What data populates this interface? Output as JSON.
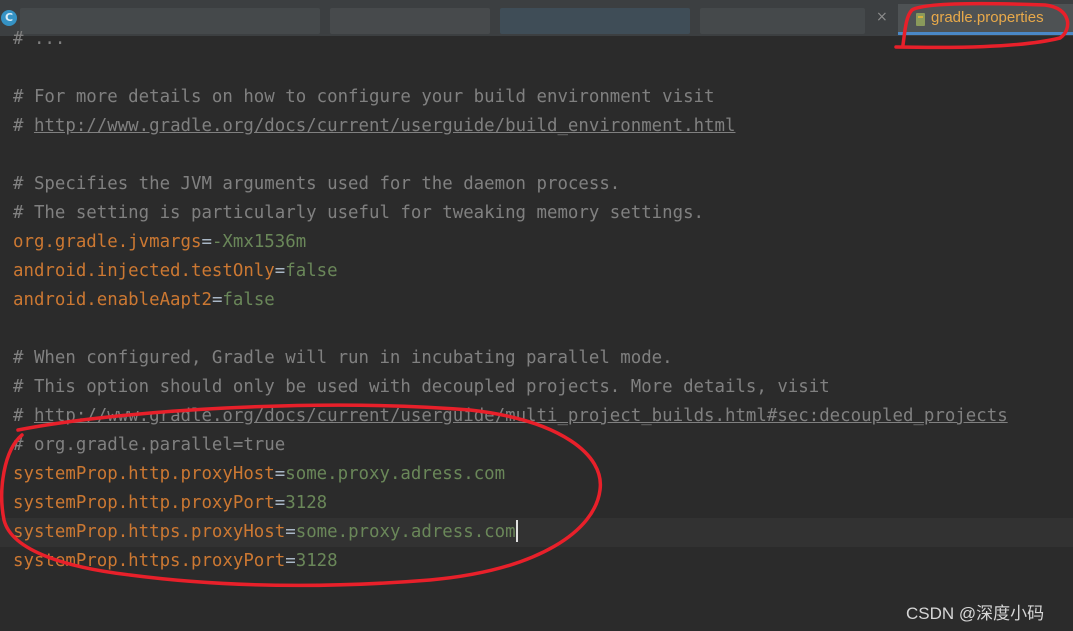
{
  "tab_bar": {
    "close_glyph": "×",
    "file_icon_char": "C",
    "active_tab_label": "gradle.properties"
  },
  "editor": {
    "lines": [
      {
        "parts": [
          {
            "t": "# ...",
            "c": "cmt"
          }
        ]
      },
      {
        "parts": []
      },
      {
        "parts": [
          {
            "t": "# For more details on how to configure your build environment visit",
            "c": "cmt"
          }
        ]
      },
      {
        "parts": [
          {
            "t": "# ",
            "c": "cmt"
          },
          {
            "t": "http://www.gradle.org/docs/current/userguide/build_environment.html",
            "c": "cmt-link"
          }
        ]
      },
      {
        "parts": []
      },
      {
        "parts": [
          {
            "t": "# Specifies the JVM arguments used for the daemon process.",
            "c": "cmt"
          }
        ]
      },
      {
        "parts": [
          {
            "t": "# The setting is particularly useful for tweaking memory settings.",
            "c": "cmt"
          }
        ]
      },
      {
        "parts": [
          {
            "t": "org.gradle.jvmargs",
            "c": "key"
          },
          {
            "t": "=",
            "c": "eq"
          },
          {
            "t": "-Xmx1536m",
            "c": "val"
          }
        ]
      },
      {
        "parts": [
          {
            "t": "android.injected.testOnly",
            "c": "key"
          },
          {
            "t": "=",
            "c": "eq"
          },
          {
            "t": "false",
            "c": "val"
          }
        ]
      },
      {
        "parts": [
          {
            "t": "android.enableAapt2",
            "c": "key"
          },
          {
            "t": "=",
            "c": "eq"
          },
          {
            "t": "false",
            "c": "val"
          }
        ]
      },
      {
        "parts": []
      },
      {
        "parts": [
          {
            "t": "# When configured, Gradle will run in incubating parallel mode.",
            "c": "cmt"
          }
        ]
      },
      {
        "parts": [
          {
            "t": "# This option should only be used with decoupled projects. More details, visit",
            "c": "cmt"
          }
        ]
      },
      {
        "parts": [
          {
            "t": "# ",
            "c": "cmt"
          },
          {
            "t": "http://www.gradle.org/docs/current/userguide/multi_project_builds.html#sec:decoupled_projects",
            "c": "cmt-link"
          }
        ]
      },
      {
        "parts": [
          {
            "t": "# org.gradle.parallel=true",
            "c": "cmt"
          }
        ]
      },
      {
        "parts": [
          {
            "t": "systemProp.http.proxyHost",
            "c": "key"
          },
          {
            "t": "=",
            "c": "eq"
          },
          {
            "t": "some.proxy.adress.com",
            "c": "val"
          }
        ]
      },
      {
        "parts": [
          {
            "t": "systemProp.http.proxyPort",
            "c": "key"
          },
          {
            "t": "=",
            "c": "eq"
          },
          {
            "t": "3128",
            "c": "val"
          }
        ]
      },
      {
        "parts": [
          {
            "t": "systemProp.https.proxyHost",
            "c": "key"
          },
          {
            "t": "=",
            "c": "eq"
          },
          {
            "t": "some.proxy.adress.com",
            "c": "val"
          }
        ],
        "caret": true
      },
      {
        "parts": [
          {
            "t": "systemProp.https.proxyPort",
            "c": "key"
          },
          {
            "t": "=",
            "c": "eq"
          },
          {
            "t": "3128",
            "c": "val"
          }
        ]
      }
    ]
  },
  "watermark": "CSDN @深度小码",
  "colors": {
    "editor_bg": "#2b2b2b",
    "comment": "#808080",
    "key": "#cc7832",
    "value": "#6a8759",
    "operator": "#a9b7c6",
    "annotation": "#e8202a"
  }
}
